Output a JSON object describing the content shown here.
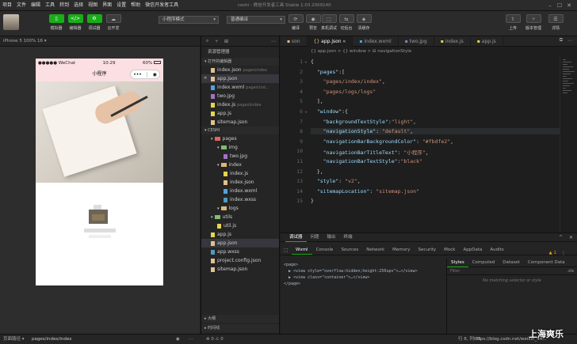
{
  "menu": [
    "项目",
    "文件",
    "编辑",
    "工具",
    "转到",
    "选择",
    "视图",
    "界面",
    "设置",
    "帮助",
    "微信开发者工具"
  ],
  "window_title": "ceshi - 微信开发者工具 Stable 1.03.2009140",
  "toolbar": {
    "left_buttons": [
      {
        "label": "模拟器",
        "glyph": "▯",
        "active": true
      },
      {
        "label": "编辑器",
        "glyph": "</>",
        "active": true
      },
      {
        "label": "调试器",
        "glyph": "⚙",
        "active": true
      },
      {
        "label": "云开发",
        "glyph": "☁",
        "active": false
      }
    ],
    "mode_select": "小程序模式",
    "compile_select": "普通编译",
    "mid_buttons": [
      "编译",
      "预览",
      "真机调试",
      "切后台",
      "清缓存"
    ],
    "right_buttons": [
      "上传",
      "版本管理",
      "详情"
    ]
  },
  "device_bar": "iPhone 5 100% 16 ▾",
  "phone": {
    "carrier": "●●●●● WeChat",
    "time": "10:29",
    "battery": "60%",
    "nav_title": "小程序",
    "capsule_dots": "•••",
    "capsule_target": "◉"
  },
  "explorer": {
    "title": "资源管理器",
    "open_editors_label": "打开的编辑器",
    "open_editors": [
      {
        "name": "index.json",
        "sub": "pages\\index",
        "type": "json"
      },
      {
        "name": "app.json",
        "sub": "",
        "type": "json",
        "selected": true
      },
      {
        "name": "index.wxml",
        "sub": "pages\\ind...",
        "type": "wxml"
      },
      {
        "name": "two.jpg",
        "sub": "",
        "type": "img"
      },
      {
        "name": "index.js",
        "sub": "pages\\index",
        "type": "js"
      },
      {
        "name": "app.js",
        "sub": "",
        "type": "js"
      },
      {
        "name": "sitemap.json",
        "sub": "",
        "type": "json"
      }
    ],
    "project_label": "CESHI",
    "tree": [
      {
        "name": "pages",
        "level": 1,
        "type": "folder-red"
      },
      {
        "name": "img",
        "level": 2,
        "type": "folder-green"
      },
      {
        "name": "two.jpg",
        "level": 3,
        "type": "img"
      },
      {
        "name": "index",
        "level": 2,
        "type": "folder"
      },
      {
        "name": "index.js",
        "level": 3,
        "type": "js"
      },
      {
        "name": "index.json",
        "level": 3,
        "type": "json"
      },
      {
        "name": "index.wxml",
        "level": 3,
        "type": "wxml"
      },
      {
        "name": "index.wxss",
        "level": 3,
        "type": "wxss"
      },
      {
        "name": "logs",
        "level": 2,
        "type": "folder"
      },
      {
        "name": "utils",
        "level": 1,
        "type": "folder-green"
      },
      {
        "name": "util.js",
        "level": 2,
        "type": "js"
      },
      {
        "name": "app.js",
        "level": 1,
        "type": "js"
      },
      {
        "name": "app.json",
        "level": 1,
        "type": "json",
        "selected": true
      },
      {
        "name": "app.wxss",
        "level": 1,
        "type": "wxss"
      },
      {
        "name": "project.config.json",
        "level": 1,
        "type": "json"
      },
      {
        "name": "sitemap.json",
        "level": 1,
        "type": "json"
      }
    ],
    "outline_label": "大纲",
    "timeline_label": "时间线"
  },
  "tabs": [
    {
      "name": "son",
      "active": false
    },
    {
      "name": "app.json",
      "active": true
    },
    {
      "name": "index.wxml",
      "active": false
    },
    {
      "name": "two.jpg",
      "active": false
    },
    {
      "name": "index.js",
      "active": false
    },
    {
      "name": "app.js",
      "active": false
    }
  ],
  "breadcrumb": "{} app.json > {} window > ⊟ navigationStyle",
  "code_lines": [
    [
      [
        "p",
        "{"
      ]
    ],
    [
      [
        "k",
        "  \"pages\""
      ],
      [
        "p",
        ":["
      ]
    ],
    [
      [
        "s",
        "    \"pages/index/index\""
      ],
      [
        "p",
        ","
      ]
    ],
    [
      [
        "s",
        "    \"pages/logs/logs\""
      ]
    ],
    [
      [
        "p",
        "  ],"
      ]
    ],
    [
      [
        "k",
        "  \"window\""
      ],
      [
        "p",
        ":{"
      ]
    ],
    [
      [
        "k",
        "    \"backgroundTextStyle\""
      ],
      [
        "p",
        ":"
      ],
      [
        "s",
        "\"light\""
      ],
      [
        "p",
        ","
      ]
    ],
    [
      [
        "k",
        "    \"navigationStyle\""
      ],
      [
        "p",
        ": "
      ],
      [
        "s",
        "\"default\""
      ],
      [
        "p",
        ","
      ]
    ],
    [
      [
        "k",
        "    \"navigationBarBackgroundColor\""
      ],
      [
        "p",
        ": "
      ],
      [
        "s",
        "\"#fbdfe2\""
      ],
      [
        "p",
        ","
      ]
    ],
    [
      [
        "k",
        "    \"navigationBarTitleText\""
      ],
      [
        "p",
        ": "
      ],
      [
        "s",
        "\"小程序\""
      ],
      [
        "p",
        ","
      ]
    ],
    [
      [
        "k",
        "    \"navigationBarTextStyle\""
      ],
      [
        "p",
        ":"
      ],
      [
        "s",
        "\"black\""
      ]
    ],
    [
      [
        "p",
        "  },"
      ]
    ],
    [
      [
        "k",
        "  \"style\""
      ],
      [
        "p",
        ": "
      ],
      [
        "s",
        "\"v2\""
      ],
      [
        "p",
        ","
      ]
    ],
    [
      [
        "k",
        "  \"sitemapLocation\""
      ],
      [
        "p",
        ": "
      ],
      [
        "s",
        "\"sitemap.json\""
      ]
    ],
    [
      [
        "p",
        "}"
      ]
    ]
  ],
  "devtools": {
    "top_tabs": [
      "调试器",
      "问题",
      "输出",
      "终端"
    ],
    "panel_tabs": [
      "Wxml",
      "Console",
      "Sources",
      "Network",
      "Memory",
      "Security",
      "Mock",
      "AppData",
      "Audits"
    ],
    "active_panel": "Wxml",
    "warn_count": "▲ 1",
    "dom_lines": [
      "<page>",
      "  ▶ <view style=\"overflow:hidden;height:250upx\">…</view>",
      "  ▶ <view class=\"container\">…</view>",
      "</page>"
    ],
    "side_tabs": [
      "Styles",
      "Computed",
      "Dataset",
      "Component Data"
    ],
    "filter_placeholder": "Filter",
    "cls_label": ".cls",
    "no_match": "No matching selector or style"
  },
  "bottom_bar": {
    "page_path_label": "页面路径 ▾",
    "page_path": "pages/index/index",
    "errors": "⊗ 0 ⚠ 0",
    "position": "行 8, 列 35",
    "watermark": "https://blog.csdn.net/weixin_44..."
  },
  "overlay_text": "上海爽乐",
  "colors": {
    "nav_bg": "#fbdfe2",
    "accent": "#1aad19"
  }
}
